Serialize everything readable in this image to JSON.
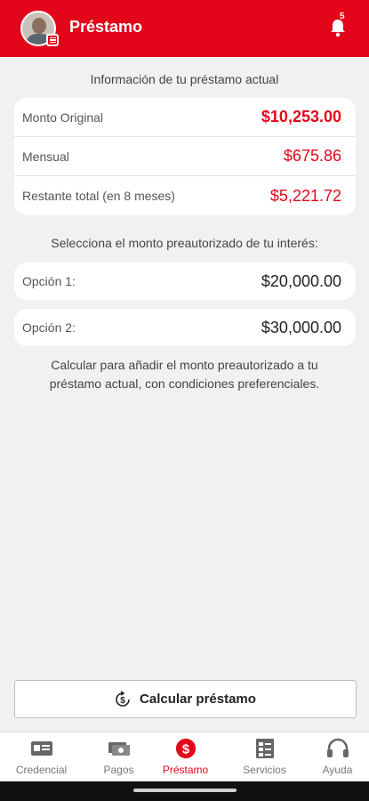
{
  "header": {
    "title": "Préstamo",
    "notification_count": "5"
  },
  "current_loan": {
    "caption": "Información de tu préstamo actual",
    "rows": [
      {
        "label": "Monto Original",
        "value": "$10,253.00"
      },
      {
        "label": "Mensual",
        "value": "$675.86"
      },
      {
        "label": "Restante total (en 8 meses)",
        "value": "$5,221.72"
      }
    ]
  },
  "preapproved": {
    "caption": "Selecciona el monto preautorizado de tu interés:",
    "options": [
      {
        "label": "Opción 1:",
        "value": "$20,000.00"
      },
      {
        "label": "Opción 2:",
        "value": "$30,000.00"
      }
    ],
    "note": "Calcular para añadir el monto preautorizado a tu préstamo actual, con condiciones preferenciales."
  },
  "calculate_button": {
    "label": "Calcular préstamo",
    "icon": "dollar-cycle-icon"
  },
  "tabs": [
    {
      "label": "Credencial",
      "icon": "id-card-icon",
      "active": false
    },
    {
      "label": "Pagos",
      "icon": "cash-icon",
      "active": false
    },
    {
      "label": "Préstamo",
      "icon": "dollar-circle-icon",
      "active": true
    },
    {
      "label": "Servicios",
      "icon": "checklist-icon",
      "active": false
    },
    {
      "label": "Ayuda",
      "icon": "headset-icon",
      "active": false
    }
  ],
  "colors": {
    "brand": "#e3061b",
    "background": "#f1f1f1"
  }
}
